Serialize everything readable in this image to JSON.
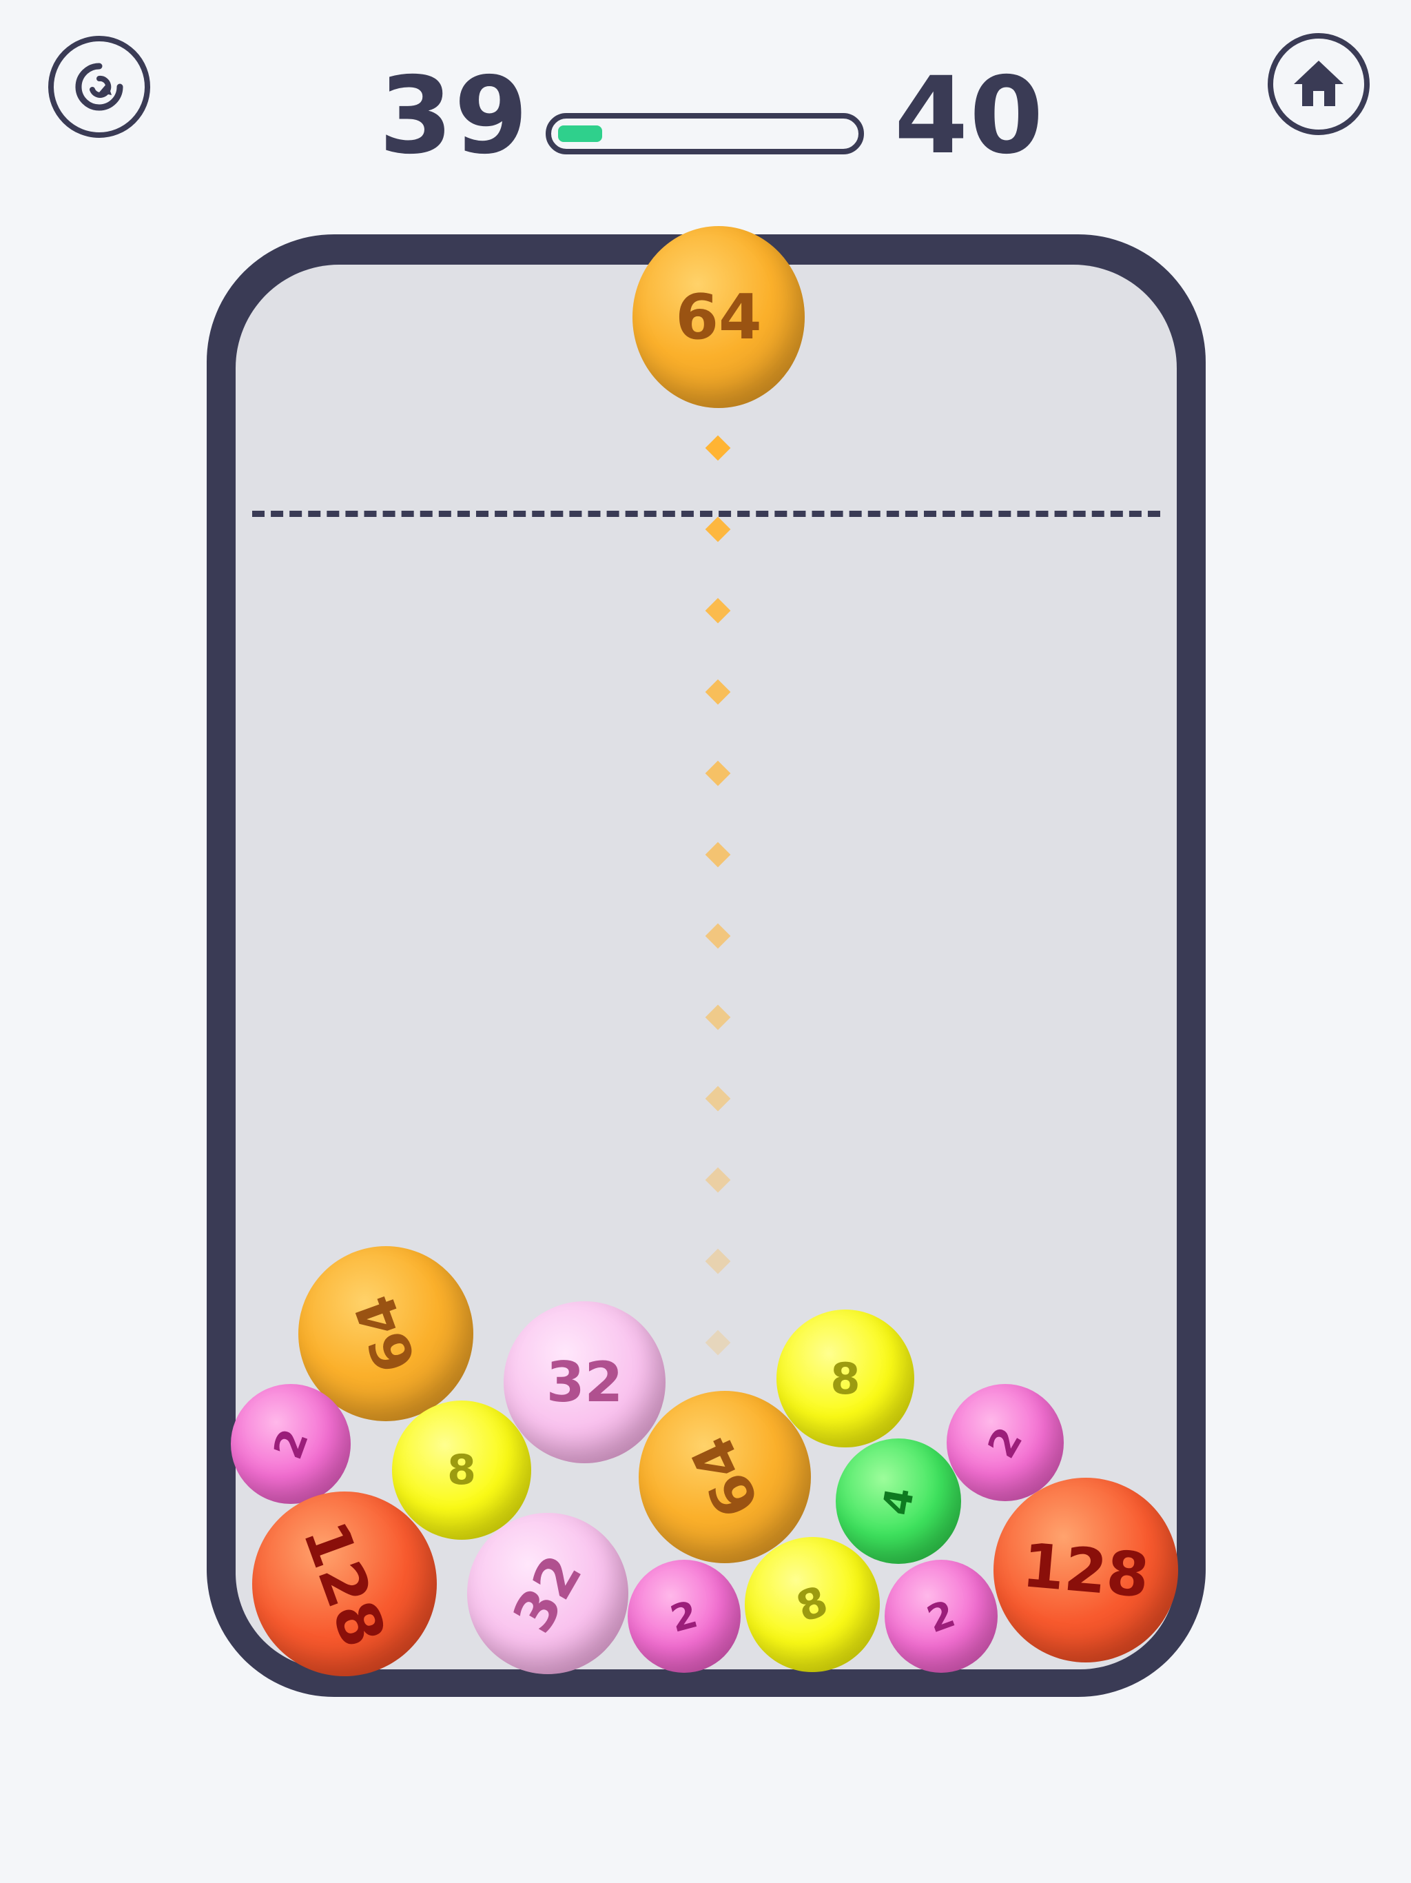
{
  "hud": {
    "restart_icon": "restart-icon",
    "home_icon": "home-icon",
    "level_current": "39",
    "level_next": "40",
    "progress": 0.15
  },
  "colors": {
    "frame": "#3a3b55",
    "progress_fill": "#2fd08c",
    "guide": "#ffb433"
  },
  "next_ball": {
    "value": "64",
    "color": "orange"
  },
  "balls": [
    {
      "value": "64",
      "color": "orange"
    },
    {
      "value": "2",
      "color": "pink"
    },
    {
      "value": "8",
      "color": "yellow"
    },
    {
      "value": "32",
      "color": "lightpink"
    },
    {
      "value": "8",
      "color": "yellow"
    },
    {
      "value": "64",
      "color": "orange"
    },
    {
      "value": "2",
      "color": "pink"
    },
    {
      "value": "4",
      "color": "green"
    },
    {
      "value": "128",
      "color": "red"
    },
    {
      "value": "32",
      "color": "lightpink"
    },
    {
      "value": "2",
      "color": "pink"
    },
    {
      "value": "8",
      "color": "yellow"
    },
    {
      "value": "2",
      "color": "pink"
    },
    {
      "value": "128",
      "color": "red"
    }
  ]
}
